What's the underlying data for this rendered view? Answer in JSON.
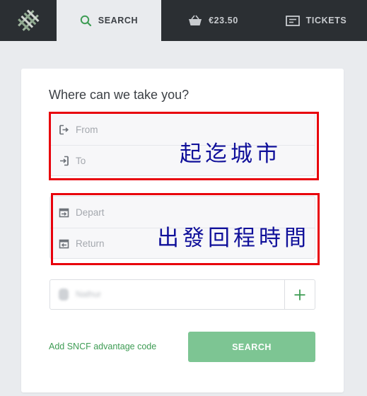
{
  "nav": {
    "logo_icon": "railway-track-logo-icon",
    "tabs": [
      {
        "label": "SEARCH",
        "icon": "search-icon",
        "active": true
      },
      {
        "label": "€23.50",
        "icon": "basket-icon",
        "active": false
      },
      {
        "label": "TICKETS",
        "icon": "ticket-icon",
        "active": false
      }
    ]
  },
  "search_form": {
    "heading": "Where can we take you?",
    "from_placeholder": "From",
    "to_placeholder": "To",
    "depart_placeholder": "Depart",
    "return_placeholder": "Return",
    "passenger_name": "Nathur",
    "add_passenger_icon": "plus-icon",
    "sncf_link": "Add SNCF advantage code",
    "search_button": "SEARCH"
  },
  "annotations": {
    "cities_label": "起迄城市",
    "dates_label": "出發回程時間",
    "color": "#e8000b",
    "text_color": "#10109a"
  },
  "colors": {
    "topbar": "#2b2f33",
    "accent_green": "#3e9c54",
    "button_green": "#7dc593"
  }
}
